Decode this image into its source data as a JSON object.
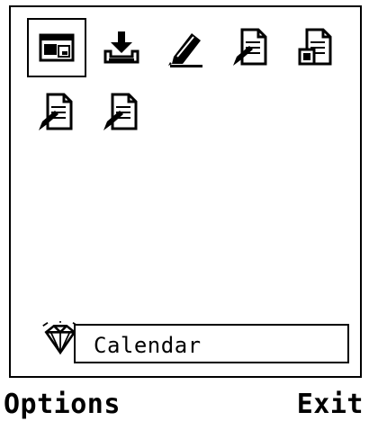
{
  "app_icons": [
    {
      "icon": "window-app-icon",
      "selected": true
    },
    {
      "icon": "download-tray-icon",
      "selected": false
    },
    {
      "icon": "pencil-icon",
      "selected": false
    },
    {
      "icon": "document-pen-icon",
      "selected": false
    },
    {
      "icon": "document-image-icon",
      "selected": false
    },
    {
      "icon": "document-pen-icon",
      "selected": false
    },
    {
      "icon": "document-pen-icon",
      "selected": false
    }
  ],
  "status_field": {
    "icon": "gem-icon",
    "text": "Calendar"
  },
  "softkeys": {
    "left": "Options",
    "right": "Exit"
  }
}
